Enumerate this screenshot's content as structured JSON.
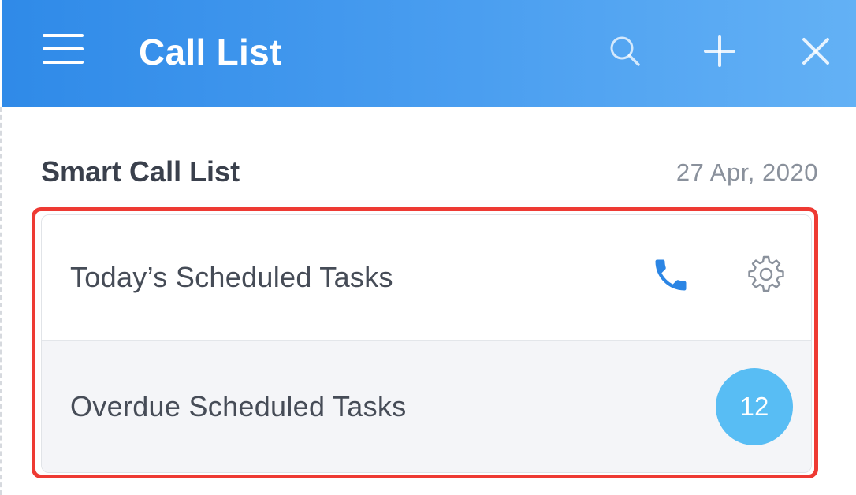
{
  "header": {
    "title": "Call List",
    "background_start": "#2f8ae8",
    "background_end": "#63b1f5",
    "icons": [
      "menu-icon",
      "search-icon",
      "plus-icon",
      "close-icon"
    ]
  },
  "section": {
    "title": "Smart Call List",
    "date": "27  Apr, 2020"
  },
  "call_list": {
    "items": [
      {
        "label": "Today’s Scheduled Tasks",
        "icons": [
          "phone-icon",
          "gear-icon"
        ],
        "phone_color": "#2b85e4"
      },
      {
        "label": "Overdue Scheduled Tasks",
        "badge": "12",
        "badge_color": "#58bdf4"
      }
    ]
  },
  "highlight": {
    "color": "#ee3a33"
  }
}
